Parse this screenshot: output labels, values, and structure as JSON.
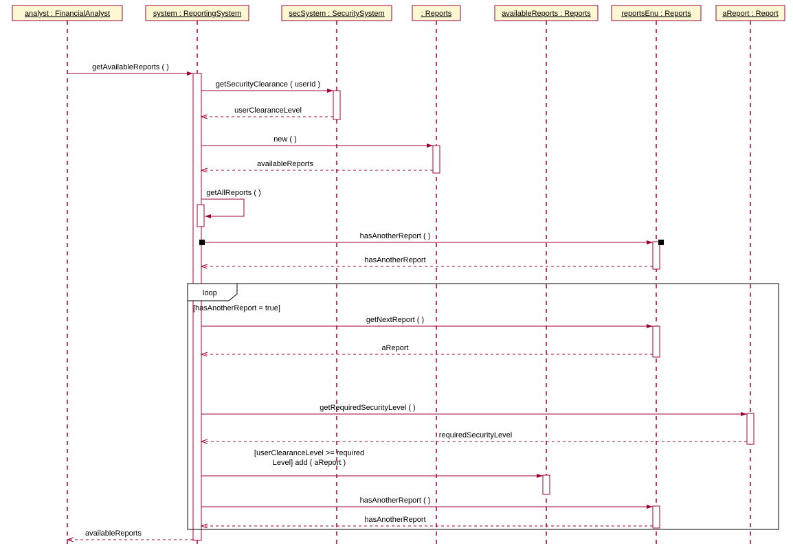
{
  "lifelines": [
    {
      "id": "analyst",
      "label": "analyst : FinancialAnalyst"
    },
    {
      "id": "system",
      "label": "system : ReportingSystem"
    },
    {
      "id": "secSystem",
      "label": "secSystem : SecuritySystem"
    },
    {
      "id": "reports",
      "label": " : Reports"
    },
    {
      "id": "avail",
      "label": "availableReports : Reports"
    },
    {
      "id": "enu",
      "label": "reportsEnu : Reports"
    },
    {
      "id": "aReport",
      "label": "aReport : Report"
    }
  ],
  "messages": {
    "m1": "getAvailableReports (  )",
    "m2": "getSecurityClearance ( userId )",
    "m3": "userClearanceLevel",
    "m4": "new (  )",
    "m5": "availableReports",
    "m6": "getAllReports (  )",
    "m7": "hasAnotherReport (  )",
    "m8": "hasAnotherReport",
    "m9": "getNextReport (  )",
    "m10": "aReport",
    "m11": "getRequiredSecurityLevel (  )",
    "m12": "requiredSecurityLevel",
    "m13": "[userClearanceLevel >= required",
    "m13b": "Level] add ( aReport )",
    "m14": "hasAnotherReport (  )",
    "m15": "hasAnotherReport",
    "m16": "availableReports"
  },
  "fragment": {
    "type": "loop",
    "guard": "[hasAnotherReport = true]"
  }
}
